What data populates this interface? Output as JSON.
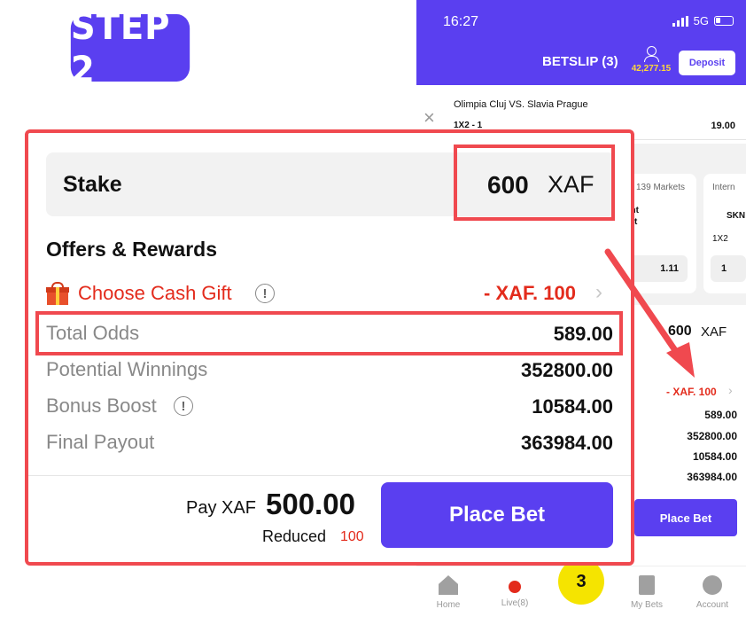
{
  "step_badge": "STEP 2",
  "phone": {
    "time": "16:27",
    "network": "5G",
    "header_title": "BETSLIP (3)",
    "balance": "42,277.15",
    "deposit_label": "Deposit",
    "selection": {
      "match": "Olimpia Cluj VS. Slavia Prague",
      "market": "1X2 - 1",
      "odd": "19.00"
    },
    "cards": {
      "markets_1": "139 Markets",
      "markets_2": "Intern",
      "team_1_line1": "cht",
      "team_1_line2": "urt",
      "team_2": "SKN",
      "label_1x2": "1X2",
      "odd_1": "1.11",
      "odd_2": "1"
    },
    "mini": {
      "stake": "600",
      "currency": "XAF",
      "gift": "- XAF. 100",
      "total_odds": "589.00",
      "potential_winnings": "352800.00",
      "bonus_boost": "10584.00",
      "final_payout": "363984.00",
      "place_bet": "Place Bet"
    },
    "tabs": {
      "home": "Home",
      "live": "Live(8)",
      "betslip_count": "3",
      "my_bets": "My Bets",
      "account": "Account"
    }
  },
  "panel": {
    "stake_label": "Stake",
    "stake_amount": "600",
    "stake_currency": "XAF",
    "offers_title": "Offers & Rewards",
    "gift_label": "Choose Cash Gift",
    "gift_amount": "- XAF. 100",
    "rows": {
      "total_odds_label": "Total Odds",
      "total_odds_value": "589.00",
      "potential_label": "Potential Winnings",
      "potential_value": "352800.00",
      "bonus_label": "Bonus Boost",
      "bonus_value": "10584.00",
      "final_label": "Final Payout",
      "final_value": "363984.00"
    },
    "pay_label": "Pay XAF",
    "pay_amount": "500.00",
    "reduced_label": "Reduced",
    "reduced_value": "100",
    "place_bet": "Place Bet"
  },
  "colors": {
    "brand": "#5a3ff0",
    "highlight": "#f0494f",
    "gift_red": "#e32b1c",
    "balance_yellow": "#ffd83a",
    "betslip_yellow": "#f5e400"
  }
}
